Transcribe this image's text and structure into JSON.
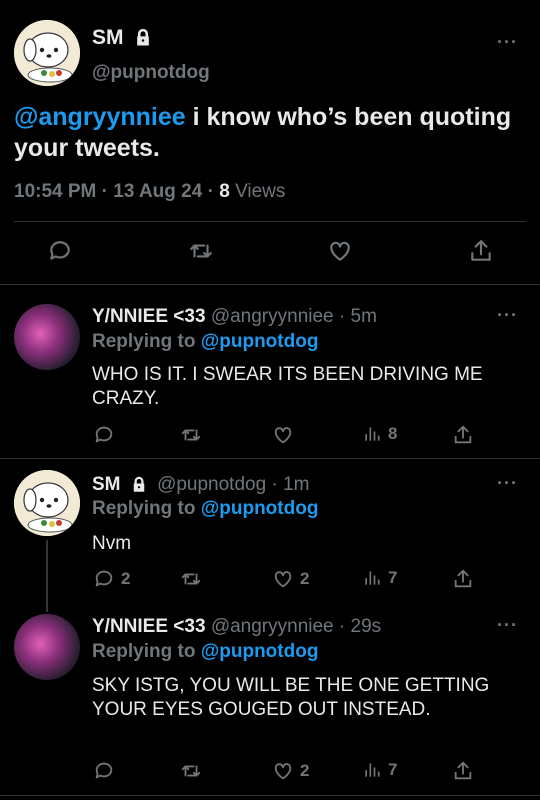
{
  "main": {
    "name": "SM",
    "handle": "@pupnotdog",
    "mention": "@angryynniee",
    "text": " i know who’s been quoting your tweets.",
    "time": "10:54 PM · 13 Aug 24 ·",
    "views_count": "8",
    "views_label": "Views",
    "more": "···"
  },
  "replies": [
    {
      "name": "Y/NNIEE <33",
      "handle": "@angryynniee",
      "time": "· 5m",
      "replying_to": "Replying to",
      "replying_handle": "@pupnotdog",
      "text": "WHO IS IT. I SWEAR ITS BEEN DRIVING ME CRAZY.",
      "replies": "",
      "retweets": "",
      "likes": "",
      "views": "8",
      "more": "···"
    },
    {
      "name": "SM",
      "handle": "@pupnotdog",
      "time": "· 1m",
      "replying_to": "Replying to",
      "replying_handle": "@pupnotdog",
      "text": "Nvm",
      "replies": "2",
      "retweets": "",
      "likes": "2",
      "views": "7",
      "more": "···"
    },
    {
      "name": "Y/NNIEE <33",
      "handle": "@angryynniee",
      "time": "· 29s",
      "replying_to": "Replying to",
      "replying_handle": "@pupnotdog",
      "text": "SKY ISTG, YOU WILL BE THE ONE GETTING YOUR EYES GOUGED OUT INSTEAD.",
      "replies": "",
      "retweets": "",
      "likes": "2",
      "views": "7",
      "more": "···"
    }
  ],
  "icons": {
    "reply": "reply-icon",
    "retweet": "retweet-icon",
    "like": "heart-icon",
    "views": "views-icon",
    "share": "share-icon",
    "lock": "lock-icon"
  },
  "colors": {
    "accent": "#1d9bf0",
    "background": "#000000",
    "muted": "#71767b"
  }
}
